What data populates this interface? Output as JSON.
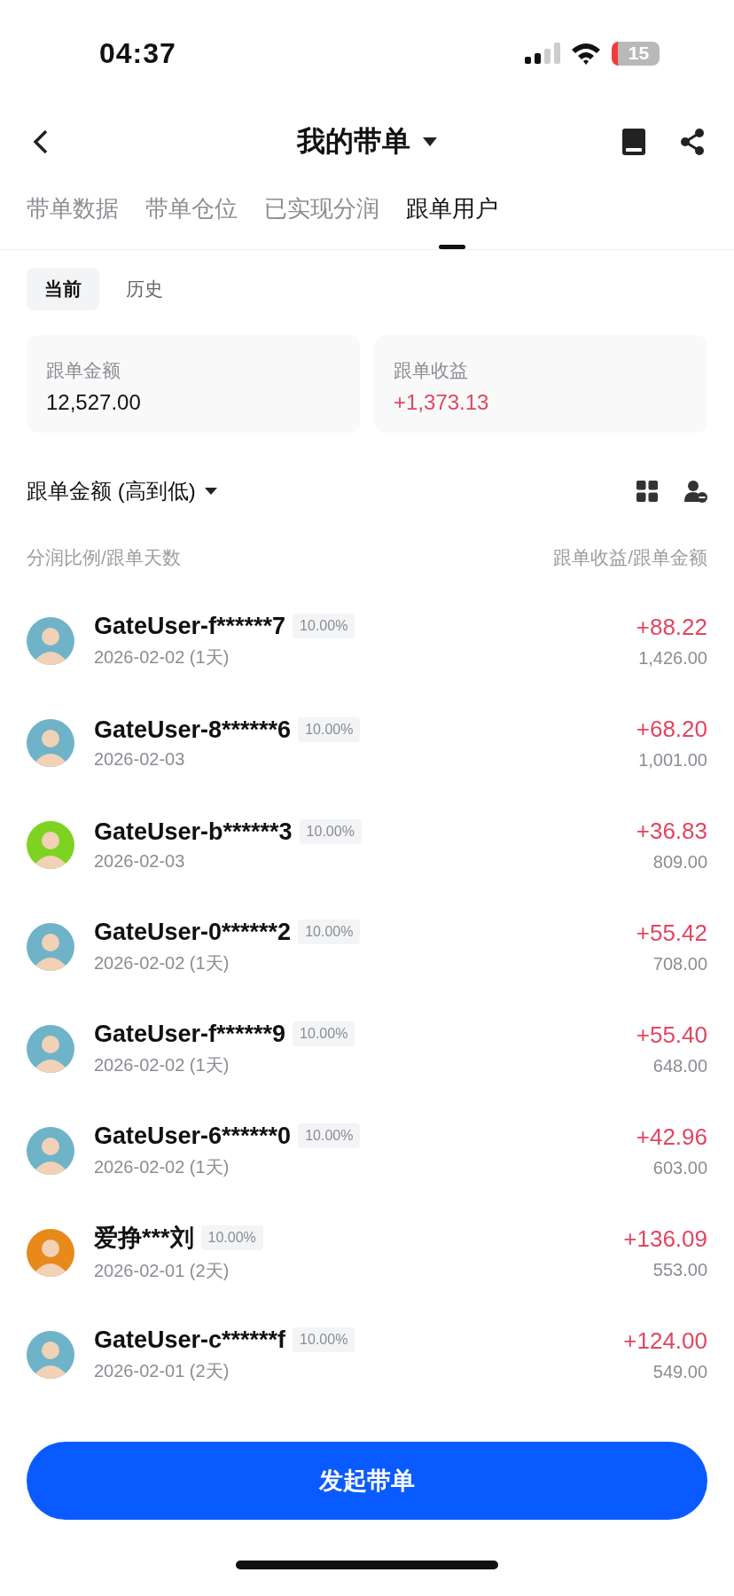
{
  "status_bar": {
    "time": "04:37",
    "battery": "15"
  },
  "header": {
    "title": "我的带单"
  },
  "tabs": [
    {
      "label": "带单数据",
      "selected": false
    },
    {
      "label": "带单仓位",
      "selected": false
    },
    {
      "label": "已实现分润",
      "selected": false
    },
    {
      "label": "跟单用户",
      "selected": true
    }
  ],
  "segments": [
    {
      "label": "当前",
      "selected": true
    },
    {
      "label": "历史",
      "selected": false
    }
  ],
  "summary": [
    {
      "label": "跟单金额",
      "value": "12,527.00",
      "kind": "plain"
    },
    {
      "label": "跟单收益",
      "value": "+1,373.13",
      "kind": "gain"
    }
  ],
  "sort": {
    "label": "跟单金额 (高到低)"
  },
  "columns": {
    "left": "分润比例/跟单天数",
    "right": "跟单收益/跟单金额"
  },
  "users": [
    {
      "name": "GateUser-f******7",
      "share": "10.00%",
      "date": "2026-02-02 (1天)",
      "profit": "+88.22",
      "amount": "1,426.00",
      "color": "#6fb3c9"
    },
    {
      "name": "GateUser-8******6",
      "share": "10.00%",
      "date": "2026-02-03",
      "profit": "+68.20",
      "amount": "1,001.00",
      "color": "#6fb3c9"
    },
    {
      "name": "GateUser-b******3",
      "share": "10.00%",
      "date": "2026-02-03",
      "profit": "+36.83",
      "amount": "809.00",
      "color": "#7ed321"
    },
    {
      "name": "GateUser-0******2",
      "share": "10.00%",
      "date": "2026-02-02 (1天)",
      "profit": "+55.42",
      "amount": "708.00",
      "color": "#6fb3c9"
    },
    {
      "name": "GateUser-f******9",
      "share": "10.00%",
      "date": "2026-02-02 (1天)",
      "profit": "+55.40",
      "amount": "648.00",
      "color": "#6fb3c9"
    },
    {
      "name": "GateUser-6******0",
      "share": "10.00%",
      "date": "2026-02-02 (1天)",
      "profit": "+42.96",
      "amount": "603.00",
      "color": "#6fb3c9"
    },
    {
      "name": "爱挣***刘",
      "share": "10.00%",
      "date": "2026-02-01 (2天)",
      "profit": "+136.09",
      "amount": "553.00",
      "color": "#e8891c"
    },
    {
      "name": "GateUser-c******f",
      "share": "10.00%",
      "date": "2026-02-01 (2天)",
      "profit": "+124.00",
      "amount": "549.00",
      "color": "#6fb3c9"
    }
  ],
  "action": {
    "label": "发起带单"
  }
}
